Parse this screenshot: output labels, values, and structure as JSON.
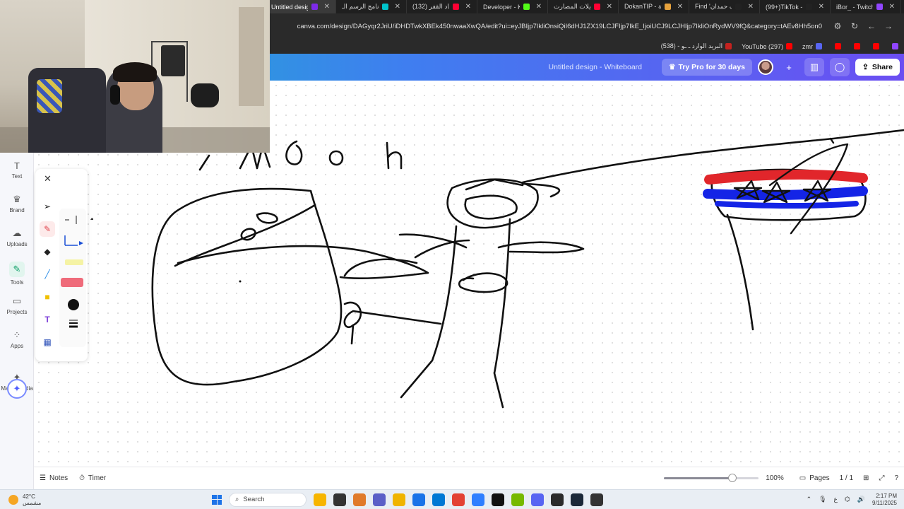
{
  "browser": {
    "tabs": [
      {
        "label": "Untitled design",
        "color": "#7d2ae8",
        "active": true
      },
      {
        "label": "برنامج الرسم الـ",
        "color": "#00c4cc"
      },
      {
        "label": "(132) جاد القفر",
        "color": "#ff0033"
      },
      {
        "label": "Developer - Ki",
        "color": "#53fc18"
      },
      {
        "label": "شيلات المصارت",
        "color": "#ff0033"
      },
      {
        "label": "DokanTIP - بية",
        "color": "#e8a33d"
      },
      {
        "label": "Find 'ف حمدان",
        "color": "#222222"
      },
      {
        "label": "(99+)TikTok - I",
        "color": "#222222"
      },
      {
        "label": "iBor_ - Twitch",
        "color": "#9146ff"
      }
    ],
    "url": "canva.com/design/DAGyqr2JriU/iDHDTwkXBEk450nwaaXwQA/edit?ui=eyJBIjp7IkliOnsiQiI6dHJ1ZX19LCJFIjp7IkE_IjoiUCJ9LCJHIjp7IkliOnRydWV9fQ&category=tAEv8Hh5on0",
    "bookmarks": [
      {
        "label": "البريد الوارد ـ ـو - (538)",
        "color": "#c5221f"
      },
      {
        "label": "YouTube (297)",
        "color": "#ff0000"
      },
      {
        "label": "zmr",
        "color": "#5865f2"
      },
      {
        "label": "",
        "color": "#ff0000"
      },
      {
        "label": "",
        "color": "#ff0000"
      },
      {
        "label": "",
        "color": "#ff0000"
      },
      {
        "label": "",
        "color": "#9146ff"
      }
    ]
  },
  "canva": {
    "doc_title": "Untitled design - Whiteboard",
    "try_pro": "Try Pro for 30 days",
    "share": "Share"
  },
  "sidebar": {
    "items": [
      {
        "label": "Text",
        "icon": "T"
      },
      {
        "label": "Brand",
        "icon": "♛"
      },
      {
        "label": "Uploads",
        "icon": "☁"
      },
      {
        "label": "Tools",
        "icon": "✎"
      },
      {
        "label": "Projects",
        "icon": "▭"
      },
      {
        "label": "Apps",
        "icon": "⁘"
      },
      {
        "label": "Magic Media",
        "icon": "✦"
      }
    ]
  },
  "footer": {
    "notes": "Notes",
    "timer": "Timer",
    "zoom": "100%",
    "zoom_level": 0.72,
    "pages": "Pages",
    "page_count": "1 / 1"
  },
  "taskbar": {
    "temperature": "42°C",
    "weather_desc": "مشمس",
    "search": "Search",
    "time": "2:17 PM",
    "date": "9/11/2025",
    "lang": "ع",
    "apps": [
      "#f7b500",
      "#333333",
      "#e07a2a",
      "#5b5fc7",
      "#f0b400",
      "#1a73e8",
      "#0078d4",
      "#e34133",
      "#2f7fff",
      "#111111",
      "#76b900",
      "#5865f2",
      "#2b2b2b",
      "#1b2838",
      "#333333"
    ]
  }
}
